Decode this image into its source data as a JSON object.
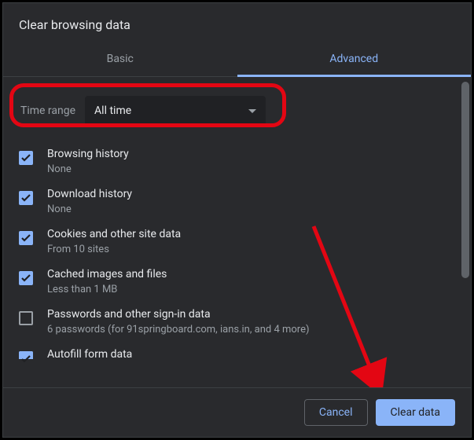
{
  "dialog": {
    "title": "Clear browsing data"
  },
  "tabs": {
    "basic": "Basic",
    "advanced": "Advanced"
  },
  "timerange": {
    "label": "Time range",
    "value": "All time"
  },
  "items": [
    {
      "title": "Browsing history",
      "desc": "None",
      "checked": true
    },
    {
      "title": "Download history",
      "desc": "None",
      "checked": true
    },
    {
      "title": "Cookies and other site data",
      "desc": "From 10 sites",
      "checked": true
    },
    {
      "title": "Cached images and files",
      "desc": "Less than 1 MB",
      "checked": true
    },
    {
      "title": "Passwords and other sign-in data",
      "desc": "6 passwords (for 91springboard.com, ians.in, and 4 more)",
      "checked": false
    },
    {
      "title": "Autofill form data",
      "desc": "",
      "checked": true
    }
  ],
  "footer": {
    "cancel": "Cancel",
    "clear": "Clear data"
  },
  "annotation": {
    "highlight": "timerange",
    "arrow_target": "clear-data-button"
  }
}
